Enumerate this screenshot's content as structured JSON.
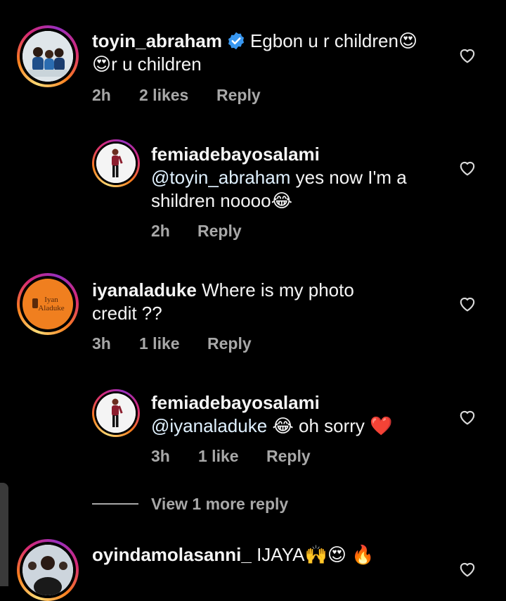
{
  "comments": [
    {
      "username": "toyin_abraham",
      "verified": true,
      "text_line1": "Egbon u r children😍",
      "text_line2": "😍r u children",
      "time": "2h",
      "likes": "2 likes",
      "reply_label": "Reply"
    },
    {
      "username": "femiadebayosalami",
      "mention": "@toyin_abraham",
      "text_after_mention": " yes now I'm a",
      "text_line2": "shildren noooo😂",
      "time": "2h",
      "reply_label": "Reply"
    },
    {
      "username": "iyanaladuke",
      "text_line1": " Where is my photo",
      "text_line2": "credit ??",
      "time": "3h",
      "likes": "1 like",
      "reply_label": "Reply",
      "avatar_text_top": "Iyan",
      "avatar_text_bottom": "Aladuke"
    },
    {
      "username": "femiadebayosalami",
      "mention": "@iyanaladuke",
      "text_after_mention": " 😂 oh sorry ❤️",
      "time": "3h",
      "likes": "1 like",
      "reply_label": "Reply"
    },
    {
      "username": "oyindamolasanni_",
      "text_line1": " IJAYA🙌😍 🔥"
    }
  ],
  "view_more_label": "View 1 more reply",
  "colors": {
    "background": "#000000",
    "text": "#f5f5f5",
    "muted": "#a8a8a8",
    "verified_blue": "#3897f0"
  }
}
